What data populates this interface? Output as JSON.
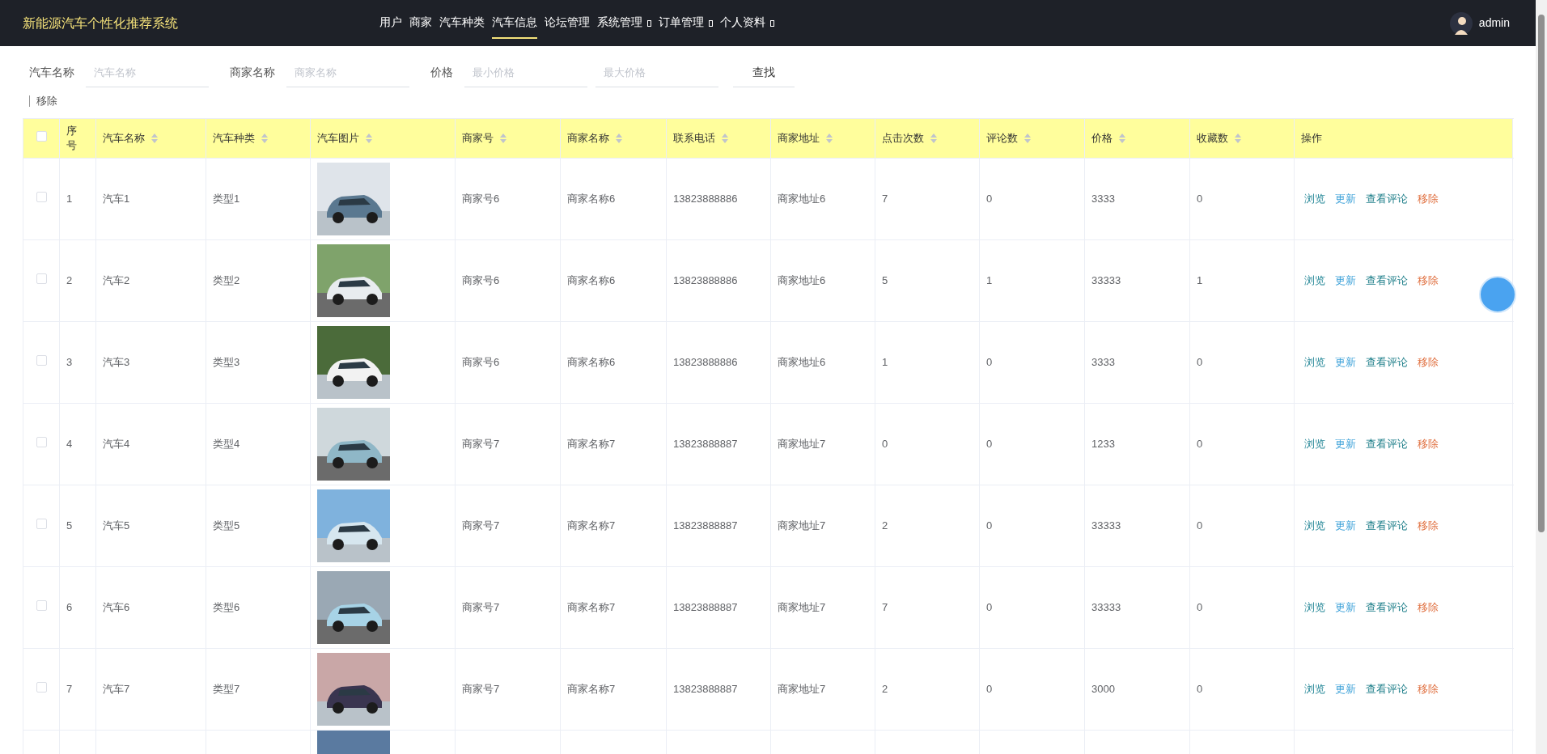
{
  "header": {
    "title": "新能源汽车个性化推荐系统",
    "nav": [
      {
        "label": "用户",
        "selected": false,
        "dropdown": false
      },
      {
        "label": "商家",
        "selected": false,
        "dropdown": false
      },
      {
        "label": "汽车种类",
        "selected": false,
        "dropdown": false
      },
      {
        "label": "汽车信息",
        "selected": true,
        "dropdown": false
      },
      {
        "label": "论坛管理",
        "selected": false,
        "dropdown": false
      },
      {
        "label": "系统管理",
        "selected": false,
        "dropdown": true
      },
      {
        "label": "订单管理",
        "selected": false,
        "dropdown": true
      },
      {
        "label": "个人资料",
        "selected": false,
        "dropdown": true
      }
    ],
    "user": "admin"
  },
  "filters": [
    {
      "label": "汽车名称",
      "fields": [
        {
          "placeholder": "汽车名称"
        }
      ]
    },
    {
      "label": "商家名称",
      "fields": [
        {
          "placeholder": "商家名称"
        }
      ]
    },
    {
      "label": "价格",
      "fields": [
        {
          "placeholder": "最小价格"
        },
        {
          "placeholder": "最大价格"
        }
      ]
    }
  ],
  "search_button": "查找",
  "remove_button": "移除",
  "table": {
    "select_all": {
      "checked": false
    },
    "columns": [
      {
        "label": "序号",
        "sortable": false
      },
      {
        "label": "汽车名称",
        "sortable": true
      },
      {
        "label": "汽车种类",
        "sortable": true
      },
      {
        "label": "汽车图片",
        "sortable": true
      },
      {
        "label": "商家号",
        "sortable": true
      },
      {
        "label": "商家名称",
        "sortable": true
      },
      {
        "label": "联系电话",
        "sortable": true
      },
      {
        "label": "商家地址",
        "sortable": true
      },
      {
        "label": "点击次数",
        "sortable": true
      },
      {
        "label": "评论数",
        "sortable": true
      },
      {
        "label": "价格",
        "sortable": true
      },
      {
        "label": "收藏数",
        "sortable": true
      },
      {
        "label": "操作",
        "sortable": false
      }
    ],
    "rows": [
      {
        "checked": false,
        "cells": [
          "1",
          "汽车1",
          "类型1",
          null,
          "商家号6",
          "商家名称6",
          "13823888886",
          "商家地址6",
          "7",
          "0",
          "3333",
          "0"
        ],
        "actions": [
          {
            "label": "浏览",
            "kind": "view"
          },
          {
            "label": "更新",
            "kind": "edit"
          },
          {
            "label": "查看评论",
            "kind": "comments"
          },
          {
            "label": "移除",
            "kind": "delete"
          }
        ]
      },
      {
        "checked": false,
        "cells": [
          "2",
          "汽车2",
          "类型2",
          null,
          "商家号6",
          "商家名称6",
          "13823888886",
          "商家地址6",
          "5",
          "1",
          "33333",
          "1"
        ],
        "actions": [
          {
            "label": "浏览",
            "kind": "view"
          },
          {
            "label": "更新",
            "kind": "edit"
          },
          {
            "label": "查看评论",
            "kind": "comments"
          },
          {
            "label": "移除",
            "kind": "delete"
          }
        ]
      },
      {
        "checked": false,
        "cells": [
          "3",
          "汽车3",
          "类型3",
          null,
          "商家号6",
          "商家名称6",
          "13823888886",
          "商家地址6",
          "1",
          "0",
          "3333",
          "0"
        ],
        "actions": [
          {
            "label": "浏览",
            "kind": "view"
          },
          {
            "label": "更新",
            "kind": "edit"
          },
          {
            "label": "查看评论",
            "kind": "comments"
          },
          {
            "label": "移除",
            "kind": "delete"
          }
        ]
      },
      {
        "checked": false,
        "cells": [
          "4",
          "汽车4",
          "类型4",
          null,
          "商家号7",
          "商家名称7",
          "13823888887",
          "商家地址7",
          "0",
          "0",
          "1233",
          "0"
        ],
        "actions": [
          {
            "label": "浏览",
            "kind": "view"
          },
          {
            "label": "更新",
            "kind": "edit"
          },
          {
            "label": "查看评论",
            "kind": "comments"
          },
          {
            "label": "移除",
            "kind": "delete"
          }
        ]
      },
      {
        "checked": false,
        "cells": [
          "5",
          "汽车5",
          "类型5",
          null,
          "商家号7",
          "商家名称7",
          "13823888887",
          "商家地址7",
          "2",
          "0",
          "33333",
          "0"
        ],
        "actions": [
          {
            "label": "浏览",
            "kind": "view"
          },
          {
            "label": "更新",
            "kind": "edit"
          },
          {
            "label": "查看评论",
            "kind": "comments"
          },
          {
            "label": "移除",
            "kind": "delete"
          }
        ]
      },
      {
        "checked": false,
        "cells": [
          "6",
          "汽车6",
          "类型6",
          null,
          "商家号7",
          "商家名称7",
          "13823888887",
          "商家地址7",
          "7",
          "0",
          "33333",
          "0"
        ],
        "actions": [
          {
            "label": "浏览",
            "kind": "view"
          },
          {
            "label": "更新",
            "kind": "edit"
          },
          {
            "label": "查看评论",
            "kind": "comments"
          },
          {
            "label": "移除",
            "kind": "delete"
          }
        ]
      },
      {
        "checked": false,
        "cells": [
          "7",
          "汽车7",
          "类型7",
          null,
          "商家号7",
          "商家名称7",
          "13823888887",
          "商家地址7",
          "2",
          "0",
          "3000",
          "0"
        ],
        "actions": [
          {
            "label": "浏览",
            "kind": "view"
          },
          {
            "label": "更新",
            "kind": "edit"
          },
          {
            "label": "查看评论",
            "kind": "comments"
          },
          {
            "label": "移除",
            "kind": "delete"
          }
        ]
      }
    ]
  }
}
